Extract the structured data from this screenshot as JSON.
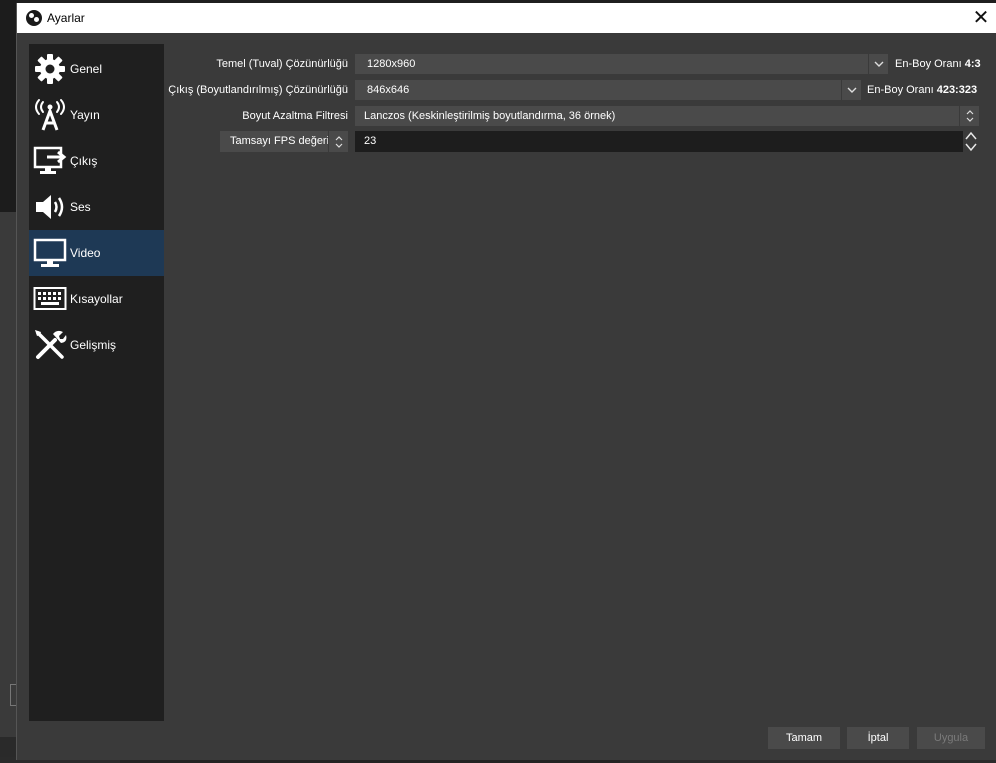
{
  "window": {
    "title": "Ayarlar",
    "close_glyph": "✕"
  },
  "sidebar": {
    "items": [
      {
        "label": "Genel",
        "icon": "gear-icon"
      },
      {
        "label": "Yayın",
        "icon": "broadcast-tower-icon"
      },
      {
        "label": "Çıkış",
        "icon": "output-monitor-icon"
      },
      {
        "label": "Ses",
        "icon": "speaker-icon"
      },
      {
        "label": "Video",
        "icon": "monitor-icon",
        "selected": true
      },
      {
        "label": "Kısayollar",
        "icon": "keyboard-icon"
      },
      {
        "label": "Gelişmiş",
        "icon": "tools-icon"
      }
    ]
  },
  "video": {
    "base_resolution": {
      "label": "Temel (Tuval) Çözünürlüğü",
      "value": "1280x960",
      "aspect_label": "En-Boy Oranı",
      "aspect_value": "4:3"
    },
    "output_resolution": {
      "label": "Çıkış (Boyutlandırılmış) Çözünürlüğü",
      "value": "846x646",
      "aspect_label": "En-Boy Oranı",
      "aspect_value": "423:323"
    },
    "downscale_filter": {
      "label": "Boyut Azaltma Filtresi",
      "value": "Lanczos (Keskinleştirilmiş boyutlandırma, 36 örnek)"
    },
    "fps": {
      "type_label": "Tamsayı FPS değeri",
      "value": "23"
    }
  },
  "buttons": {
    "ok": "Tamam",
    "cancel": "İptal",
    "apply": "Uygula"
  },
  "colors": {
    "dialog_bg": "#3a3a3a",
    "sidebar_bg": "#1f1f1f",
    "selected_bg": "#1e3955",
    "control_bg": "#4a4a4a"
  }
}
